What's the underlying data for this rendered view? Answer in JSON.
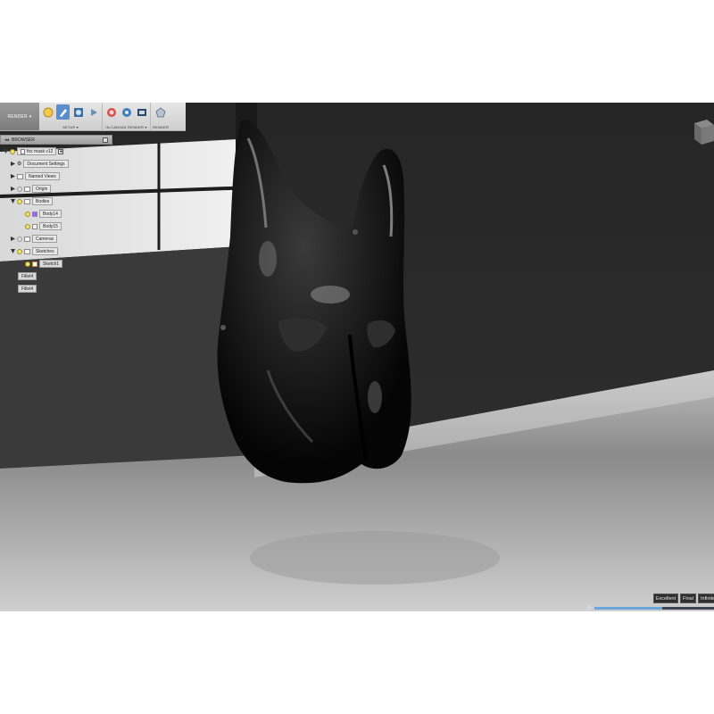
{
  "toolbar": {
    "workspace_label": "RENDER",
    "groups": [
      {
        "label": "SETUP",
        "icons": [
          "scene-settings-icon",
          "appearance-icon",
          "environment-icon",
          "decal-icon"
        ]
      },
      {
        "label": "IN-CANVAS RENDER",
        "icons": [
          "in-canvas-render-icon",
          "render-settings-icon",
          "capture-image-icon"
        ]
      },
      {
        "label": "RENDER",
        "icons": [
          "render-icon"
        ]
      }
    ]
  },
  "browser": {
    "header": "BROWSER",
    "root": "fox mask v12",
    "items": {
      "document_settings": "Document Settings",
      "named_views": "Named Views",
      "origin": "Origin",
      "bodies": "Bodies",
      "body1": "Body14",
      "body2": "Body15",
      "cameras": "Cameras",
      "sketches": "Sketches",
      "sketch1": "Sketch1",
      "fillet1": "Fillet4",
      "fillet2": "Fillet4"
    }
  },
  "quality": {
    "options": [
      "Excellent",
      "Final",
      "Infinite"
    ],
    "progress": 0.57,
    "accent": "#6aa7d8"
  },
  "colors": {
    "toolbar_active": "#5a8fcf",
    "viewport_wall": "#2a2a2a",
    "mask": "#0a0a0a"
  }
}
